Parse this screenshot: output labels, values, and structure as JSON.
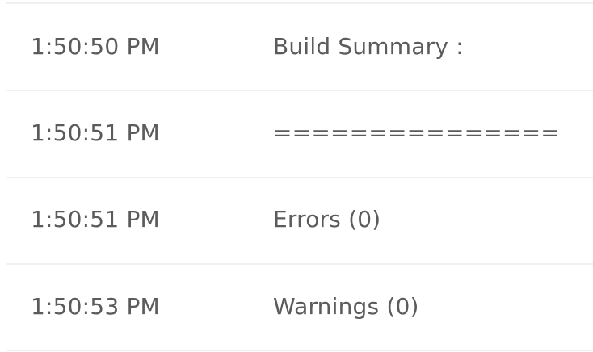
{
  "log": {
    "rows": [
      {
        "time": "1:50:50 PM",
        "message": "Build Summary :"
      },
      {
        "time": "1:50:51 PM",
        "message": "==============="
      },
      {
        "time": "1:50:51 PM",
        "message": "Errors (0)"
      },
      {
        "time": "1:50:53 PM",
        "message": "Warnings (0)"
      }
    ]
  }
}
